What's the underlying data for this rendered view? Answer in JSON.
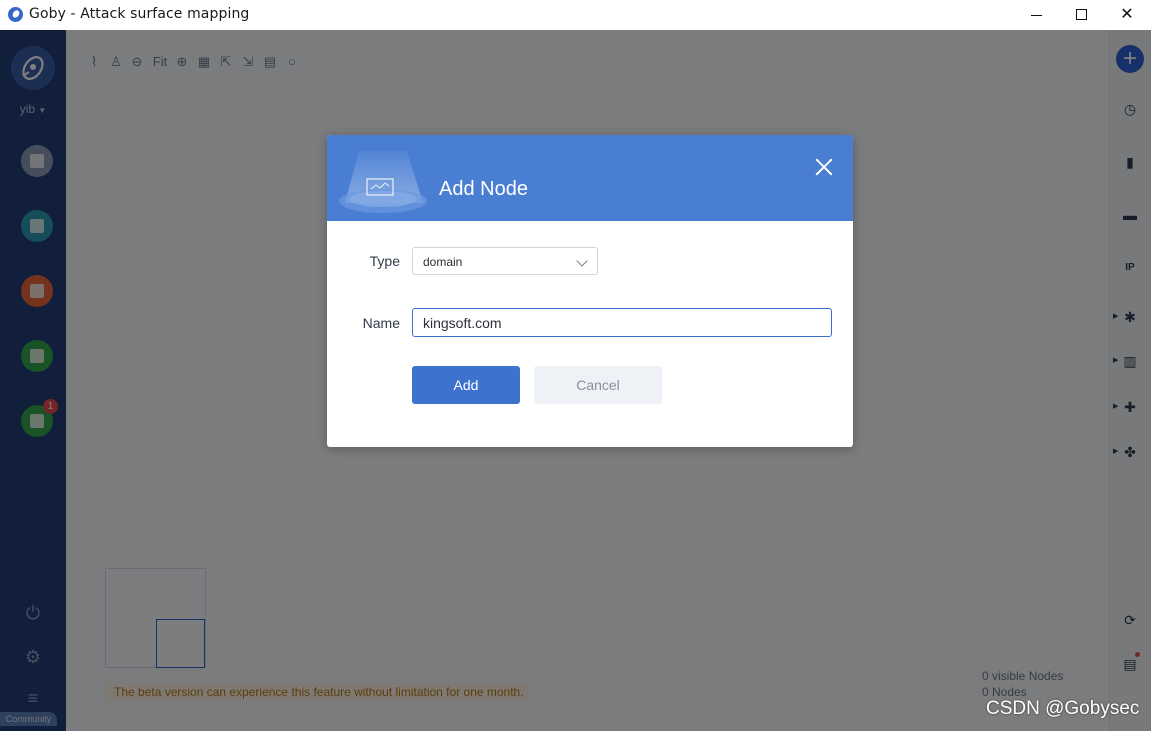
{
  "window": {
    "title": "Goby - Attack surface mapping",
    "controls": {
      "minimize_icon": "minimize-icon",
      "maximize_icon": "maximize-icon",
      "close_icon": "close-icon"
    }
  },
  "sidebar": {
    "user": "yib",
    "items": [
      {
        "icon": "scan-icon",
        "color": "#8e9cb6"
      },
      {
        "icon": "assets-icon",
        "color": "#2a9db1"
      },
      {
        "icon": "report-icon",
        "color": "#e7663a"
      },
      {
        "icon": "chart-icon",
        "color": "#35a94c"
      },
      {
        "icon": "extension-icon",
        "color": "#35a94c",
        "badge": "1"
      }
    ],
    "power_icon": "power-icon",
    "settings_icon": "settings-icon",
    "menu_icon": "menu-icon",
    "community_label": "Community"
  },
  "toolbar": {
    "fit_label": "Fit"
  },
  "canvas": {
    "beta_notice": "The beta version can experience this feature without limitation for one month.",
    "visible_nodes": "0 visible Nodes",
    "nodes": "0 Nodes"
  },
  "modal": {
    "title": "Add Node",
    "type_label": "Type",
    "type_value": "domain",
    "name_label": "Name",
    "name_value": "kingsoft.com",
    "add_label": "Add",
    "cancel_label": "Cancel"
  },
  "watermark": "CSDN @Gobysec"
}
